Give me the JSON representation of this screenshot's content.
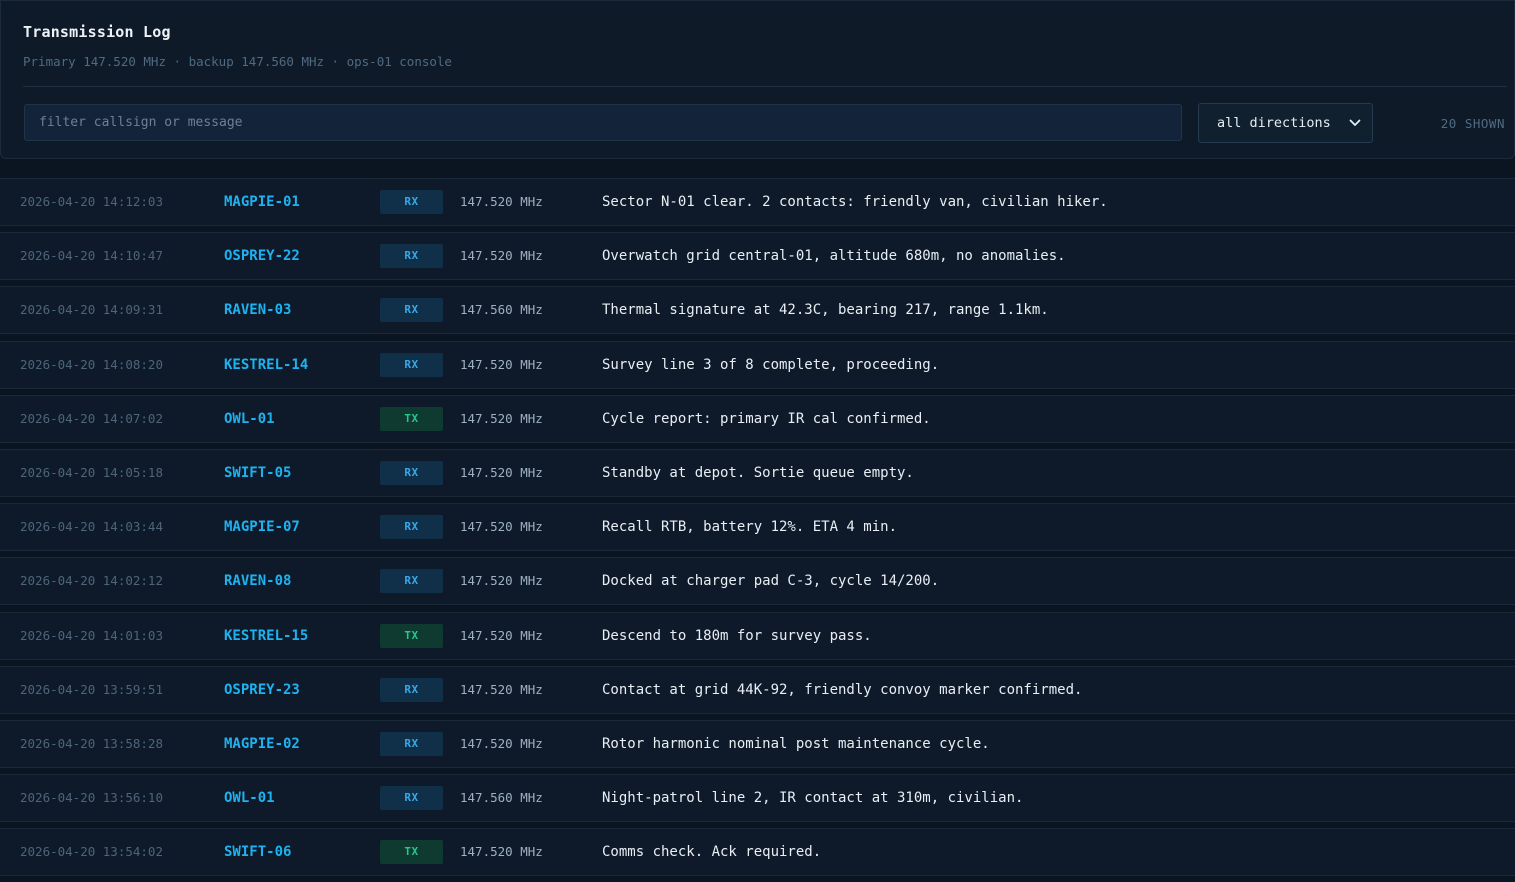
{
  "header": {
    "title": "Transmission Log",
    "subtitle": "Primary 147.520 MHz · backup 147.560 MHz · ops-01 console"
  },
  "filter": {
    "placeholder": "filter callsign or message",
    "direction_selected": "all directions",
    "shown_count": "20 SHOWN"
  },
  "colors": {
    "callsign": "#1fb2f0",
    "rx_badge": "#38a8e8",
    "tx_badge": "#22c98a",
    "background": "#0b1522"
  },
  "icons": {
    "select": "chevron-down-icon"
  },
  "rows": [
    {
      "timestamp": "2026-04-20 14:12:03",
      "callsign": "MAGPIE-01",
      "direction": "RX",
      "frequency": "147.520 MHz",
      "message": "Sector N-01 clear. 2 contacts: friendly van, civilian hiker."
    },
    {
      "timestamp": "2026-04-20 14:10:47",
      "callsign": "OSPREY-22",
      "direction": "RX",
      "frequency": "147.520 MHz",
      "message": "Overwatch grid central-01, altitude 680m, no anomalies."
    },
    {
      "timestamp": "2026-04-20 14:09:31",
      "callsign": "RAVEN-03",
      "direction": "RX",
      "frequency": "147.560 MHz",
      "message": "Thermal signature at 42.3C, bearing 217, range 1.1km."
    },
    {
      "timestamp": "2026-04-20 14:08:20",
      "callsign": "KESTREL-14",
      "direction": "RX",
      "frequency": "147.520 MHz",
      "message": "Survey line 3 of 8 complete, proceeding."
    },
    {
      "timestamp": "2026-04-20 14:07:02",
      "callsign": "OWL-01",
      "direction": "TX",
      "frequency": "147.520 MHz",
      "message": "Cycle report: primary IR cal confirmed."
    },
    {
      "timestamp": "2026-04-20 14:05:18",
      "callsign": "SWIFT-05",
      "direction": "RX",
      "frequency": "147.520 MHz",
      "message": "Standby at depot. Sortie queue empty."
    },
    {
      "timestamp": "2026-04-20 14:03:44",
      "callsign": "MAGPIE-07",
      "direction": "RX",
      "frequency": "147.520 MHz",
      "message": "Recall RTB, battery 12%. ETA 4 min."
    },
    {
      "timestamp": "2026-04-20 14:02:12",
      "callsign": "RAVEN-08",
      "direction": "RX",
      "frequency": "147.520 MHz",
      "message": "Docked at charger pad C-3, cycle 14/200."
    },
    {
      "timestamp": "2026-04-20 14:01:03",
      "callsign": "KESTREL-15",
      "direction": "TX",
      "frequency": "147.520 MHz",
      "message": "Descend to 180m for survey pass."
    },
    {
      "timestamp": "2026-04-20 13:59:51",
      "callsign": "OSPREY-23",
      "direction": "RX",
      "frequency": "147.520 MHz",
      "message": "Contact at grid 44K-92, friendly convoy marker confirmed."
    },
    {
      "timestamp": "2026-04-20 13:58:28",
      "callsign": "MAGPIE-02",
      "direction": "RX",
      "frequency": "147.520 MHz",
      "message": "Rotor harmonic nominal post maintenance cycle."
    },
    {
      "timestamp": "2026-04-20 13:56:10",
      "callsign": "OWL-01",
      "direction": "RX",
      "frequency": "147.560 MHz",
      "message": "Night-patrol line 2, IR contact at 310m, civilian."
    },
    {
      "timestamp": "2026-04-20 13:54:02",
      "callsign": "SWIFT-06",
      "direction": "TX",
      "frequency": "147.520 MHz",
      "message": "Comms check. Ack required."
    }
  ]
}
